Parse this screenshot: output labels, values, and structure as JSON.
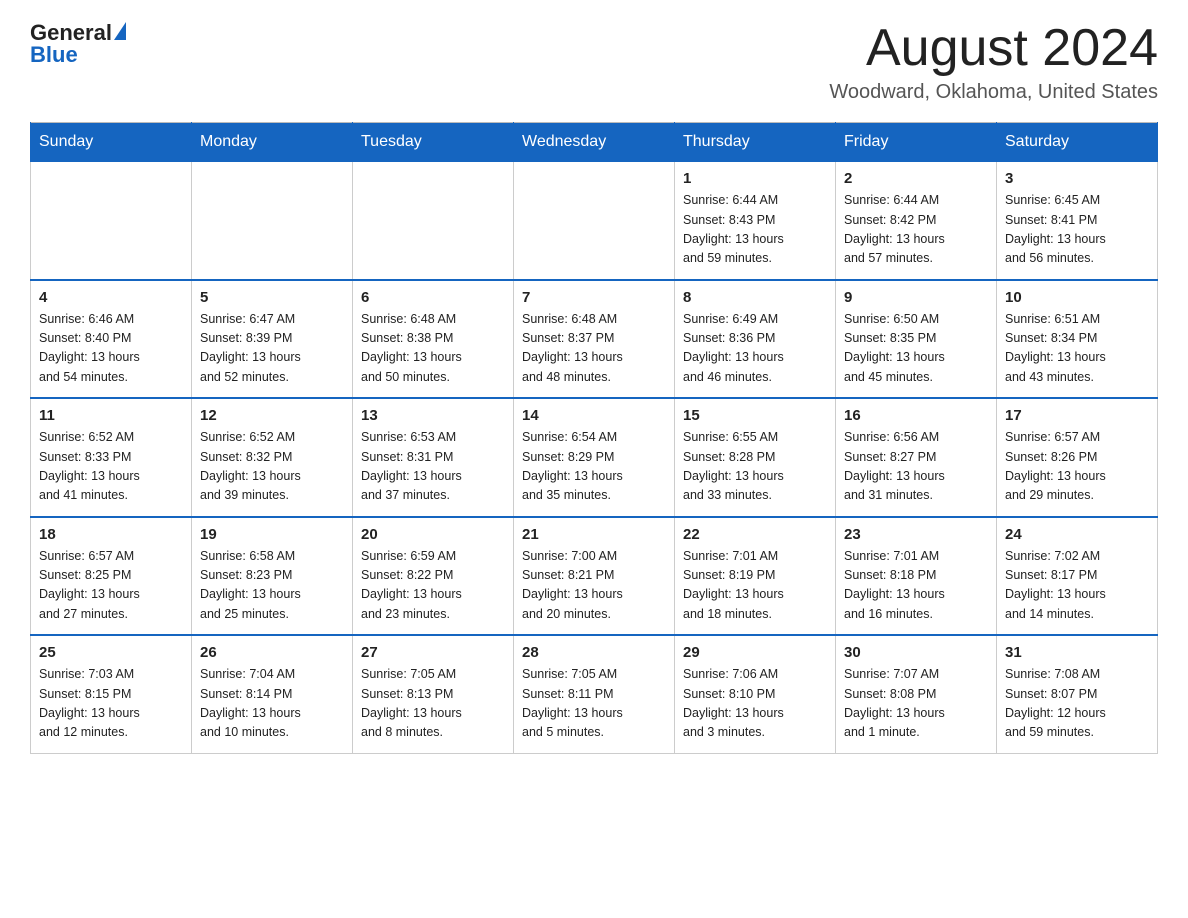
{
  "header": {
    "logo_general": "General",
    "logo_blue": "Blue",
    "month_title": "August 2024",
    "location": "Woodward, Oklahoma, United States"
  },
  "days_of_week": [
    "Sunday",
    "Monday",
    "Tuesday",
    "Wednesday",
    "Thursday",
    "Friday",
    "Saturday"
  ],
  "weeks": [
    [
      {
        "day": "",
        "info": ""
      },
      {
        "day": "",
        "info": ""
      },
      {
        "day": "",
        "info": ""
      },
      {
        "day": "",
        "info": ""
      },
      {
        "day": "1",
        "info": "Sunrise: 6:44 AM\nSunset: 8:43 PM\nDaylight: 13 hours\nand 59 minutes."
      },
      {
        "day": "2",
        "info": "Sunrise: 6:44 AM\nSunset: 8:42 PM\nDaylight: 13 hours\nand 57 minutes."
      },
      {
        "day": "3",
        "info": "Sunrise: 6:45 AM\nSunset: 8:41 PM\nDaylight: 13 hours\nand 56 minutes."
      }
    ],
    [
      {
        "day": "4",
        "info": "Sunrise: 6:46 AM\nSunset: 8:40 PM\nDaylight: 13 hours\nand 54 minutes."
      },
      {
        "day": "5",
        "info": "Sunrise: 6:47 AM\nSunset: 8:39 PM\nDaylight: 13 hours\nand 52 minutes."
      },
      {
        "day": "6",
        "info": "Sunrise: 6:48 AM\nSunset: 8:38 PM\nDaylight: 13 hours\nand 50 minutes."
      },
      {
        "day": "7",
        "info": "Sunrise: 6:48 AM\nSunset: 8:37 PM\nDaylight: 13 hours\nand 48 minutes."
      },
      {
        "day": "8",
        "info": "Sunrise: 6:49 AM\nSunset: 8:36 PM\nDaylight: 13 hours\nand 46 minutes."
      },
      {
        "day": "9",
        "info": "Sunrise: 6:50 AM\nSunset: 8:35 PM\nDaylight: 13 hours\nand 45 minutes."
      },
      {
        "day": "10",
        "info": "Sunrise: 6:51 AM\nSunset: 8:34 PM\nDaylight: 13 hours\nand 43 minutes."
      }
    ],
    [
      {
        "day": "11",
        "info": "Sunrise: 6:52 AM\nSunset: 8:33 PM\nDaylight: 13 hours\nand 41 minutes."
      },
      {
        "day": "12",
        "info": "Sunrise: 6:52 AM\nSunset: 8:32 PM\nDaylight: 13 hours\nand 39 minutes."
      },
      {
        "day": "13",
        "info": "Sunrise: 6:53 AM\nSunset: 8:31 PM\nDaylight: 13 hours\nand 37 minutes."
      },
      {
        "day": "14",
        "info": "Sunrise: 6:54 AM\nSunset: 8:29 PM\nDaylight: 13 hours\nand 35 minutes."
      },
      {
        "day": "15",
        "info": "Sunrise: 6:55 AM\nSunset: 8:28 PM\nDaylight: 13 hours\nand 33 minutes."
      },
      {
        "day": "16",
        "info": "Sunrise: 6:56 AM\nSunset: 8:27 PM\nDaylight: 13 hours\nand 31 minutes."
      },
      {
        "day": "17",
        "info": "Sunrise: 6:57 AM\nSunset: 8:26 PM\nDaylight: 13 hours\nand 29 minutes."
      }
    ],
    [
      {
        "day": "18",
        "info": "Sunrise: 6:57 AM\nSunset: 8:25 PM\nDaylight: 13 hours\nand 27 minutes."
      },
      {
        "day": "19",
        "info": "Sunrise: 6:58 AM\nSunset: 8:23 PM\nDaylight: 13 hours\nand 25 minutes."
      },
      {
        "day": "20",
        "info": "Sunrise: 6:59 AM\nSunset: 8:22 PM\nDaylight: 13 hours\nand 23 minutes."
      },
      {
        "day": "21",
        "info": "Sunrise: 7:00 AM\nSunset: 8:21 PM\nDaylight: 13 hours\nand 20 minutes."
      },
      {
        "day": "22",
        "info": "Sunrise: 7:01 AM\nSunset: 8:19 PM\nDaylight: 13 hours\nand 18 minutes."
      },
      {
        "day": "23",
        "info": "Sunrise: 7:01 AM\nSunset: 8:18 PM\nDaylight: 13 hours\nand 16 minutes."
      },
      {
        "day": "24",
        "info": "Sunrise: 7:02 AM\nSunset: 8:17 PM\nDaylight: 13 hours\nand 14 minutes."
      }
    ],
    [
      {
        "day": "25",
        "info": "Sunrise: 7:03 AM\nSunset: 8:15 PM\nDaylight: 13 hours\nand 12 minutes."
      },
      {
        "day": "26",
        "info": "Sunrise: 7:04 AM\nSunset: 8:14 PM\nDaylight: 13 hours\nand 10 minutes."
      },
      {
        "day": "27",
        "info": "Sunrise: 7:05 AM\nSunset: 8:13 PM\nDaylight: 13 hours\nand 8 minutes."
      },
      {
        "day": "28",
        "info": "Sunrise: 7:05 AM\nSunset: 8:11 PM\nDaylight: 13 hours\nand 5 minutes."
      },
      {
        "day": "29",
        "info": "Sunrise: 7:06 AM\nSunset: 8:10 PM\nDaylight: 13 hours\nand 3 minutes."
      },
      {
        "day": "30",
        "info": "Sunrise: 7:07 AM\nSunset: 8:08 PM\nDaylight: 13 hours\nand 1 minute."
      },
      {
        "day": "31",
        "info": "Sunrise: 7:08 AM\nSunset: 8:07 PM\nDaylight: 12 hours\nand 59 minutes."
      }
    ]
  ]
}
